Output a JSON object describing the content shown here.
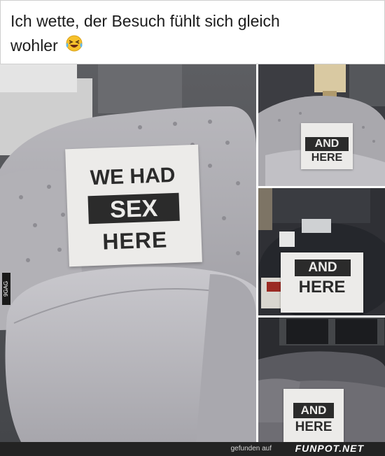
{
  "caption": {
    "line1": "Ich wette, der Besuch fühlt sich gleich",
    "line2": "wohler",
    "emoji": "laughing-crying-emoji"
  },
  "main_photo": {
    "pillow_line1": "WE HAD",
    "pillow_line2": "SEX",
    "pillow_line3": "HERE",
    "watermark": "9GAG"
  },
  "side_photos": [
    {
      "line1": "AND",
      "line2": "HERE"
    },
    {
      "line1": "AND",
      "line2": "HERE"
    },
    {
      "line1": "AND",
      "line2": "HERE"
    }
  ],
  "footer": {
    "prefix": "gefunden auf",
    "brand": "FUNPOT.NET"
  }
}
